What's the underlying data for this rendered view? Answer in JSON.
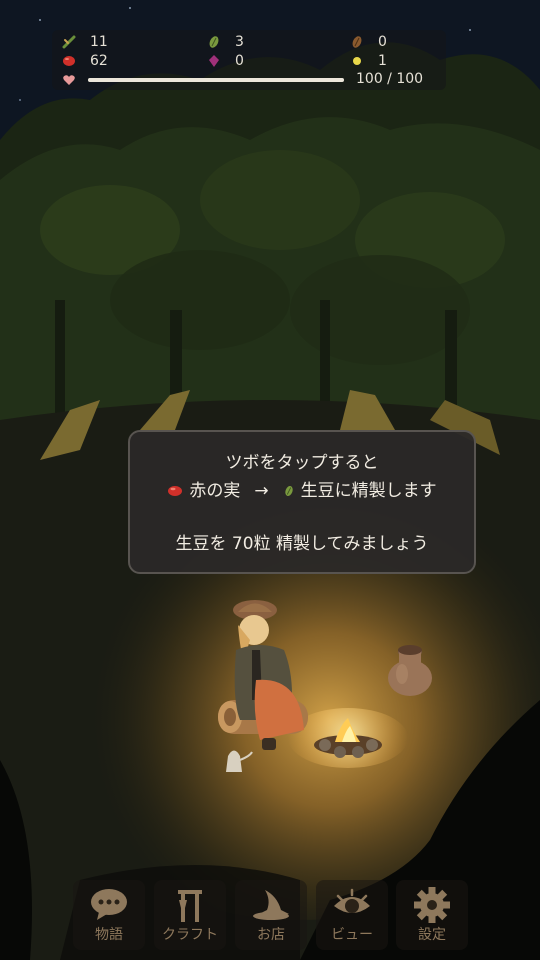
{
  "hud": {
    "resources": [
      {
        "name": "wood",
        "icon": "stick-icon",
        "color": "#6a8f3a",
        "value": "11"
      },
      {
        "name": "green-beans",
        "icon": "green-bean-icon",
        "color": "#7a9a3e",
        "value": "3"
      },
      {
        "name": "roasted-beans",
        "icon": "brown-bean-icon",
        "color": "#8a5a2e",
        "value": "0"
      },
      {
        "name": "red-berries",
        "icon": "red-berry-icon",
        "color": "#d0302a",
        "value": "62"
      },
      {
        "name": "purple-gems",
        "icon": "purple-gem-icon",
        "color": "#a0307a",
        "value": "0"
      },
      {
        "name": "gold",
        "icon": "gold-dot-icon",
        "color": "#e8d84a",
        "value": "1"
      }
    ],
    "hp": {
      "icon": "heart-icon",
      "current": 100,
      "max": 100,
      "text": "100 / 100"
    }
  },
  "dialog": {
    "line1": "ツボをタップすると",
    "item_from": "赤の実",
    "arrow": "→",
    "item_to": "生豆に精製します",
    "line3": "生豆を 70粒 精製してみましょう"
  },
  "nav": [
    {
      "id": "story",
      "label": "物語",
      "icon": "speech-bubble-icon"
    },
    {
      "id": "craft",
      "label": "クラフト",
      "icon": "tools-icon"
    },
    {
      "id": "shop",
      "label": "お店",
      "icon": "witch-hat-icon"
    },
    {
      "id": "view",
      "label": "ビュー",
      "icon": "eye-icon"
    },
    {
      "id": "settings",
      "label": "設定",
      "icon": "gear-icon"
    }
  ],
  "colors": {
    "panel": "#2a2827",
    "nav_icon": "#8e785c",
    "text": "#ece6da"
  }
}
